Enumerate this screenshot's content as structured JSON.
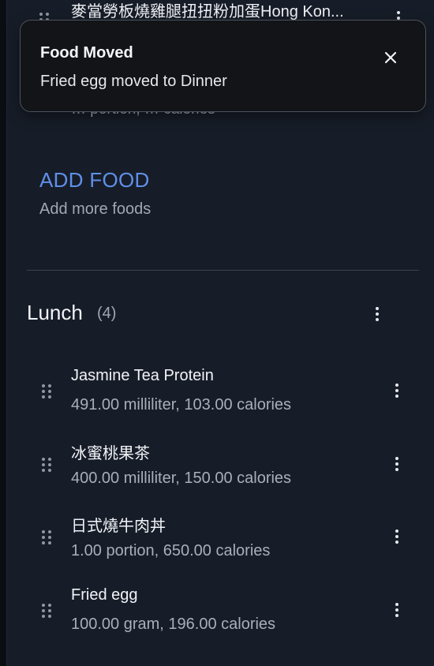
{
  "toast": {
    "title": "Food Moved",
    "message": "Fried egg moved to Dinner",
    "close_icon": "close-icon"
  },
  "previous_meal": {
    "partial_item_name": "麥當勞板燒雞腿扭扭粉加蛋Hong Kon...",
    "obscured_item_detail": "… portion, … calories",
    "add_food_label": "ADD FOOD",
    "add_food_hint": "Add more foods"
  },
  "lunch": {
    "title": "Lunch",
    "count": "(4)",
    "menu_icon": "more-vertical-icon",
    "items": [
      {
        "name": "Jasmine Tea Protein",
        "detail": "491.00 milliliter, 103.00 calories"
      },
      {
        "name": "冰蜜桃果茶",
        "detail": "400.00 milliliter, 150.00 calories"
      },
      {
        "name": "日式燒牛肉丼",
        "detail": "1.00 portion, 650.00 calories"
      },
      {
        "name": "Fried egg",
        "detail": "100.00 gram, 196.00 calories"
      }
    ]
  },
  "icons": {
    "drag": "drag-handle-icon",
    "more": "more-vertical-icon"
  },
  "colors": {
    "background": "#171d28",
    "accent": "#5f90ea",
    "toast_bg": "#121418"
  }
}
